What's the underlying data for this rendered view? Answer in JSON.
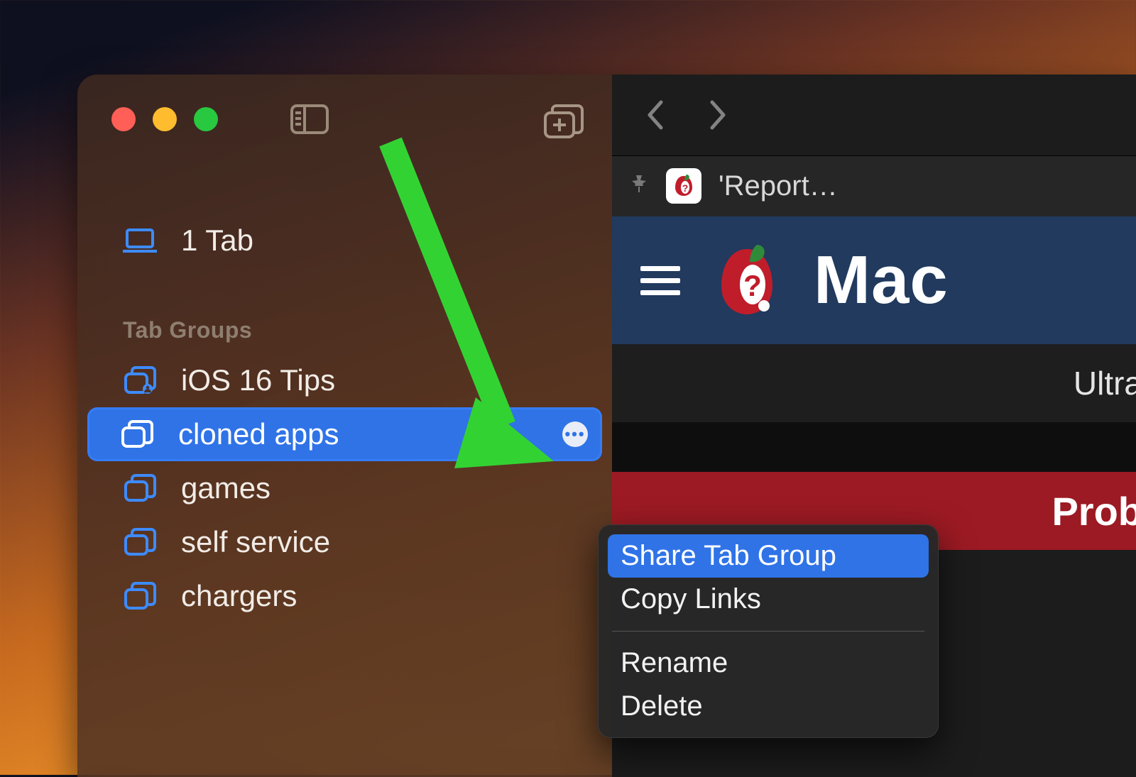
{
  "sidebar": {
    "local_tabs_label": "1 Tab",
    "section_title": "Tab Groups",
    "groups": [
      {
        "label": "iOS 16 Tips",
        "shared": true,
        "selected": false
      },
      {
        "label": "cloned apps",
        "shared": false,
        "selected": true
      },
      {
        "label": "games",
        "shared": false,
        "selected": false
      },
      {
        "label": "self service",
        "shared": false,
        "selected": false
      },
      {
        "label": "chargers",
        "shared": false,
        "selected": false
      }
    ]
  },
  "context_menu": {
    "items": [
      {
        "label": "Share Tab Group",
        "highlighted": true
      },
      {
        "label": "Copy Links",
        "highlighted": false
      }
    ],
    "items2": [
      {
        "label": "Rename"
      },
      {
        "label": "Delete"
      }
    ]
  },
  "content": {
    "pinned_tab_title": "'Report…",
    "brand_text": "Mac",
    "ultra_text": "Ultra",
    "prob_text": "Prob"
  },
  "colors": {
    "selection_blue": "#2f73e7",
    "site_navy": "#213a5e",
    "site_red": "#9c1a23",
    "arrow_green": "#33d233"
  }
}
